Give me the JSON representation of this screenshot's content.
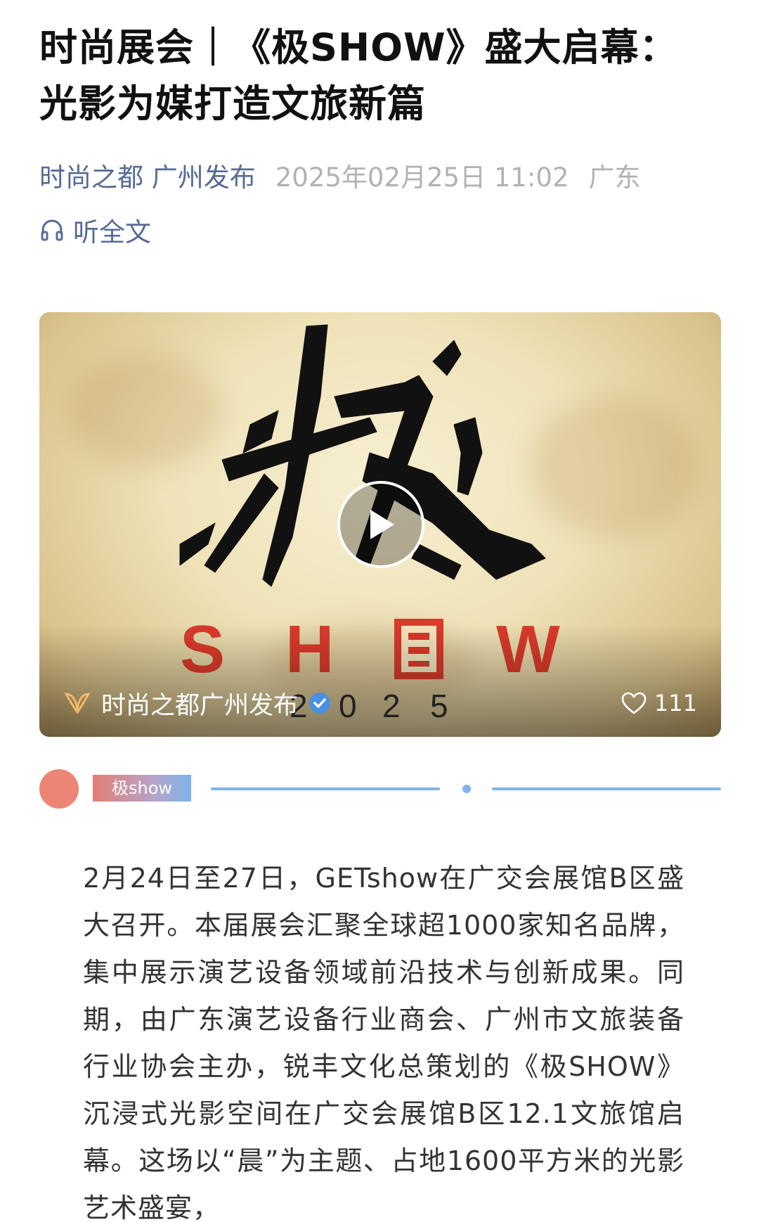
{
  "article": {
    "title": "时尚展会｜《极SHOW》盛大启幕：光影为媒打造文旅新篇",
    "author": "时尚之都 广州发布",
    "date": "2025年02月25日 11:02",
    "region": "广东",
    "listen_label": "听全文"
  },
  "video": {
    "channel_name": "时尚之都广州发布",
    "likes": "111",
    "poster_letters": [
      "S",
      "H",
      "W"
    ],
    "poster_year": [
      "2",
      "0",
      "2",
      "5"
    ]
  },
  "divider": {
    "tag": "极show",
    "accent_colors": [
      "#ec8575",
      "#7fb4ec"
    ]
  },
  "body": {
    "paragraph": "2月24日至27日，GETshow在广交会展馆B区盛大召开。本届展会汇聚全球超1000家知名品牌，集中展示演艺设备领域前沿技术与创新成果。同期，由广东演艺设备行业商会、广州市文旅装备行业协会主办，锐丰文化总策划的《极SHOW》沉浸式光影空间在广交会展馆B区12.1文旅馆启幕。这场以“晨”为主题、占地1600平方米的光影艺术盛宴，"
  },
  "icons": {
    "listen": "headphones-icon",
    "play": "play-icon",
    "channel_logo": "channel-logo-icon",
    "verified": "verified-badge-icon",
    "like": "heart-icon"
  }
}
